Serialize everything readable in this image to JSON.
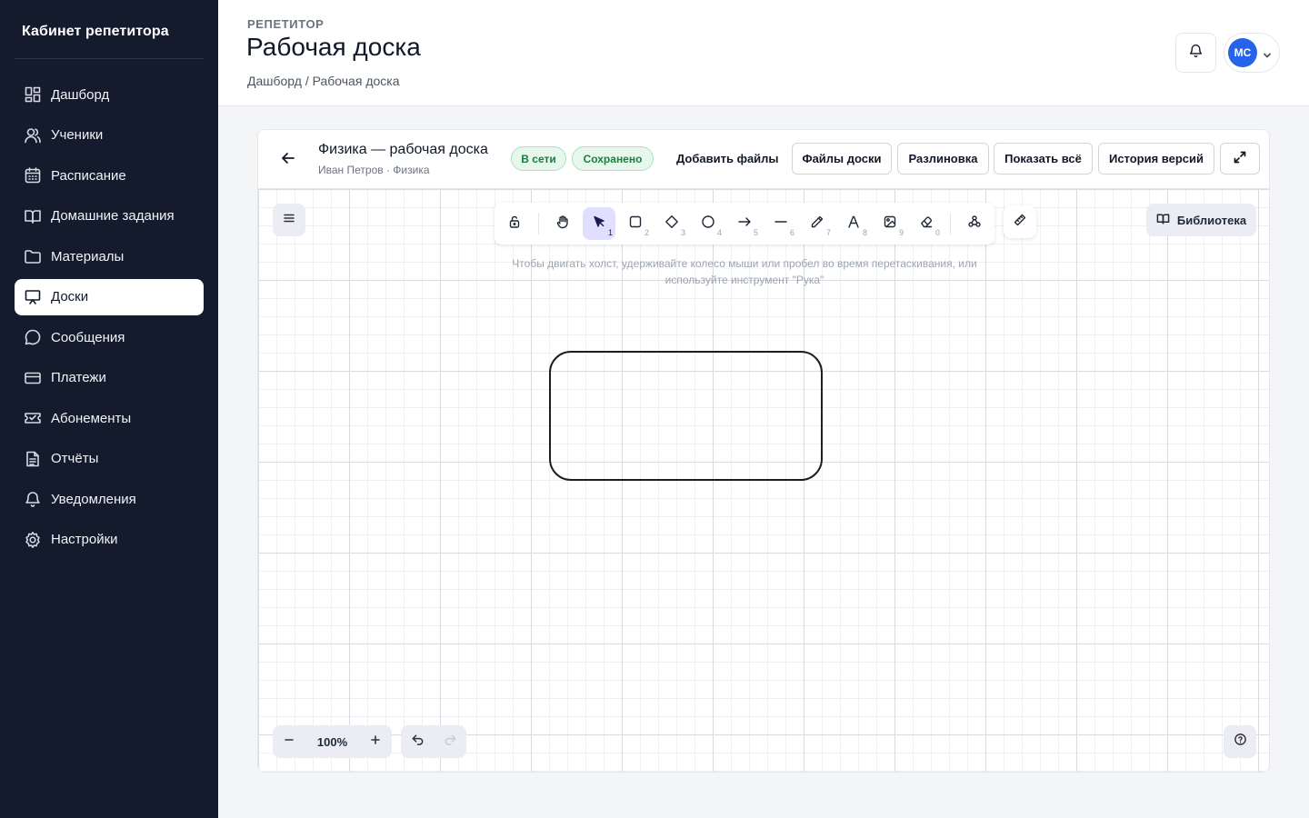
{
  "sidebar": {
    "brand": "Кабинет репетитора",
    "items": [
      {
        "label": "Дашборд",
        "icon": "dashboard-icon"
      },
      {
        "label": "Ученики",
        "icon": "users-icon"
      },
      {
        "label": "Расписание",
        "icon": "calendar-icon"
      },
      {
        "label": "Домашние задания",
        "icon": "book-icon"
      },
      {
        "label": "Материалы",
        "icon": "folder-icon"
      },
      {
        "label": "Доски",
        "icon": "presentation-icon",
        "active": true
      },
      {
        "label": "Сообщения",
        "icon": "chat-icon"
      },
      {
        "label": "Платежи",
        "icon": "credit-card-icon"
      },
      {
        "label": "Абонементы",
        "icon": "ticket-icon"
      },
      {
        "label": "Отчёты",
        "icon": "report-icon"
      },
      {
        "label": "Уведомления",
        "icon": "bell-icon"
      },
      {
        "label": "Настройки",
        "icon": "gear-icon"
      }
    ]
  },
  "header": {
    "eyebrow": "РЕПЕТИТОР",
    "title": "Рабочая доска",
    "breadcrumb": "Дашборд / Рабочая доска",
    "avatar_initials": "МС"
  },
  "board": {
    "title": "Физика — рабочая доска",
    "subtitle": "Иван Петров · Физика",
    "status_online": "В сети",
    "status_saved": "Сохранено",
    "add_files": "Добавить файлы",
    "board_files": "Файлы доски",
    "lining": "Разлиновка",
    "show_all": "Показать всё",
    "version_history": "История версий"
  },
  "canvas": {
    "hint": "Чтобы двигать холст, удерживайте колесо мыши или пробел во время перетаскивания, или используйте инструмент \"Рука\"",
    "library": "Библиотека",
    "zoom": "100%",
    "tools": [
      {
        "name": "lock-icon",
        "key": ""
      },
      {
        "name": "hand-icon",
        "key": ""
      },
      {
        "name": "pointer-icon",
        "key": "1",
        "active": true
      },
      {
        "name": "rectangle-icon",
        "key": "2"
      },
      {
        "name": "diamond-icon",
        "key": "3"
      },
      {
        "name": "ellipse-icon",
        "key": "4"
      },
      {
        "name": "arrow-icon",
        "key": "5"
      },
      {
        "name": "line-icon",
        "key": "6"
      },
      {
        "name": "pencil-icon",
        "key": "7"
      },
      {
        "name": "text-icon",
        "key": "8"
      },
      {
        "name": "image-icon",
        "key": "9"
      },
      {
        "name": "eraser-icon",
        "key": "0"
      },
      {
        "name": "shapes-icon",
        "key": ""
      }
    ]
  },
  "colors": {
    "sidebar_bg": "#141b2d",
    "accent": "#2563eb",
    "badge_green": "#16803c",
    "tool_active": "#e0dfff"
  }
}
